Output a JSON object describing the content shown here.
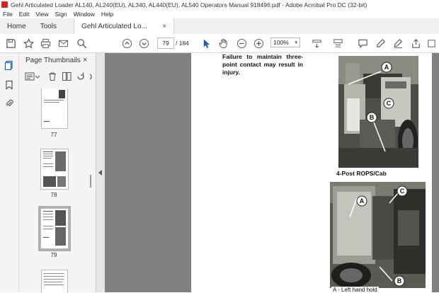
{
  "window": {
    "title": "Gehl Articulated Loader AL140, AL240(EU), AL340, AL440(EU), AL540 Operators Manual 918496.pdf - Adobe Acrobat Pro DC (32-bit)"
  },
  "menu": {
    "items": [
      "File",
      "Edit",
      "View",
      "Sign",
      "Window",
      "Help"
    ]
  },
  "tabs": {
    "home": "Home",
    "tools": "Tools",
    "doc": "Gehl Articulated Lo...",
    "doc_close": "×"
  },
  "toolbar": {
    "page_current": "79",
    "page_total": "/ 184",
    "zoom": "100%"
  },
  "thumbnails": {
    "title": "Page Thumbnails",
    "close": "×",
    "pages": [
      {
        "num": "77"
      },
      {
        "num": "78"
      },
      {
        "num": "79",
        "selected": true
      }
    ]
  },
  "document": {
    "warning_text": "Failure to maintain three-point contact may result in injury.",
    "caption1": "4-Post ROPS/Cab",
    "caption2": "A - Left hand hold",
    "callouts": [
      "A",
      "B",
      "C"
    ]
  }
}
